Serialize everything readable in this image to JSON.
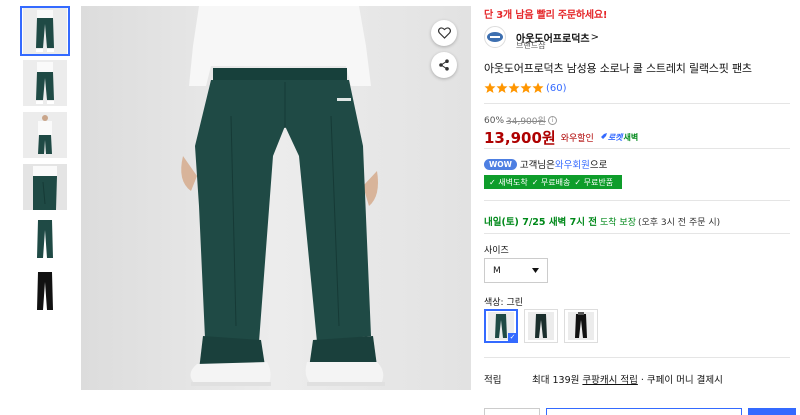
{
  "urgency": "단 3개 남음 빨리 주문하세요!",
  "brand": {
    "name": "아웃도어프로덕츠",
    "chevron": ">",
    "sub": "브랜드샵"
  },
  "product_title": "아웃도어프로덕츠 남성용 소로나 쿨 스트레치 릴랙스핏 팬츠",
  "rating": {
    "stars": 5,
    "count": "(60)"
  },
  "price": {
    "discount_rate": "60%",
    "original": "34,900원",
    "info_icon": "i",
    "sale": "13,900원",
    "wow_label": "와우할인",
    "rocket_label": "로켓",
    "dawn_label": "새벽"
  },
  "wow": {
    "badge": "WOW",
    "prefix": "고객님은 ",
    "link": "와우회원",
    "suffix": "으로"
  },
  "benefits": [
    "✓ 새벽도착",
    "✓ 무료배송",
    "✓ 무료반품"
  ],
  "delivery": {
    "date": "내일(토) 7/25 새벽 7시 전",
    "guarantee": "도착 보장",
    "note": "(오후 3시 전 주문 시)"
  },
  "size": {
    "label": "사이즈",
    "selected": "M"
  },
  "color": {
    "label": "색상: 그린",
    "options": [
      "green",
      "dark-green",
      "black"
    ],
    "selected_index": 0
  },
  "reward": {
    "label": "적립",
    "prefix": "최대 139원 ",
    "link": "쿠팡캐시 적립",
    "suffix": " · 쿠페이 머니 결제시"
  },
  "colors": {
    "sale": "#ae0000",
    "accent": "#346aff",
    "urgency": "#e52528",
    "benefit_bg": "#0e9d2b",
    "pants_green": "#1f4a45"
  }
}
